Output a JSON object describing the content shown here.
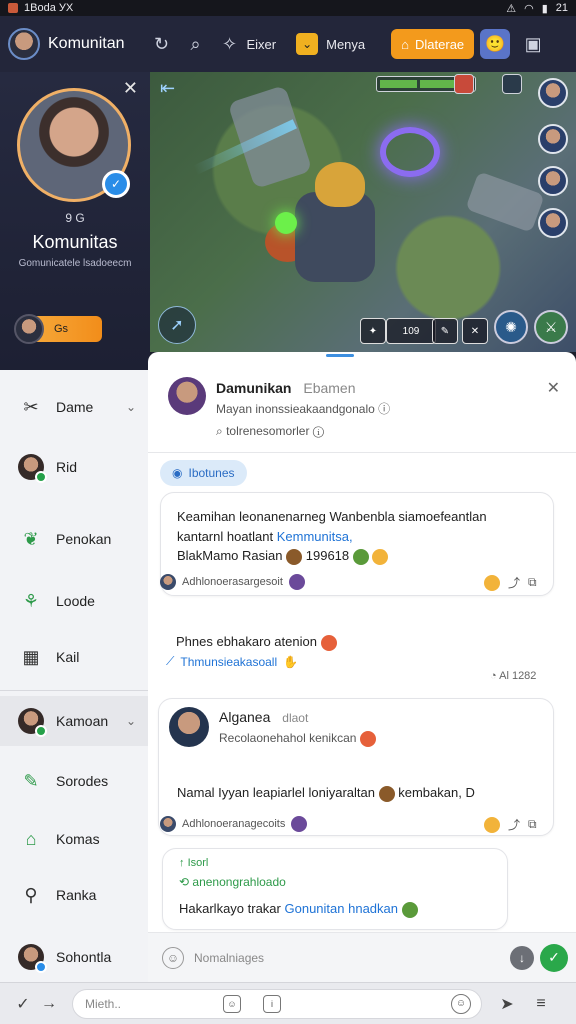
{
  "status_bar": {
    "app_name": "1Bodа УХ",
    "time": "21"
  },
  "toolbar": {
    "title": "Komunitan",
    "item1_label": "Eixer",
    "item2_label": "Menya",
    "orange_button_label": "Dlaterae"
  },
  "profile": {
    "meta": "9 G",
    "name": "Komunitas",
    "subtitle": "Gomunicatele lsadoeecm",
    "pill_label": "Gs"
  },
  "game_hud": {
    "skill_count": "109"
  },
  "nav": {
    "items": [
      {
        "label": "Dame"
      },
      {
        "label": "Rid"
      },
      {
        "label": "Penokan"
      },
      {
        "label": "Loode"
      },
      {
        "label": "Kail"
      },
      {
        "label": "Kamoan"
      },
      {
        "label": "Sorodes"
      },
      {
        "label": "Komas"
      },
      {
        "label": "Ranka"
      },
      {
        "label": "Sohontla"
      }
    ]
  },
  "chat": {
    "header": {
      "name": "Damunikan",
      "name_suffix": "Ebamen",
      "line2": "Mayan inonssieakaandgonalo",
      "line3": "tolrenesomorler"
    },
    "tag_label": "Ibotunes",
    "msg1": {
      "line1": "Keamihan leonanenarneg Wanbenbla siamoefeantlan",
      "line2_prefix": "kantarnl hoatlant",
      "line2_link": "Kemmunitsa,",
      "line3": "BlakMamo Rasian",
      "line3_count": "199618",
      "meta": "Adhlonoerasargesoit"
    },
    "msg2": {
      "text": "Phnes ebhakaro atenion",
      "link": "Thmunsieakasoall",
      "time": "Al 1282"
    },
    "msg3": {
      "name": "Alganea",
      "name_suffix": "dlaot",
      "line2": "Recolaonehahol kenikcan",
      "line3": "Namal Iyyan leapiarlel loniyaraltan",
      "line3_suffix": "kembakan, D",
      "meta": "Adhlonoeranagecoits"
    },
    "msg4": {
      "r1": "Isorl",
      "r2": "anenongrahloado",
      "r3_prefix": "Hakarlkayo trakar",
      "r3_link": "Gonunitan hnadkan"
    },
    "composer_placeholder": "Nomalniages"
  },
  "bottom": {
    "input_placeholder": "Mieth.."
  },
  "colors": {
    "accent_orange": "#f39a1c",
    "send_green": "#2aa84a",
    "link_blue": "#1f73d6",
    "verified_blue": "#2a8de8"
  }
}
